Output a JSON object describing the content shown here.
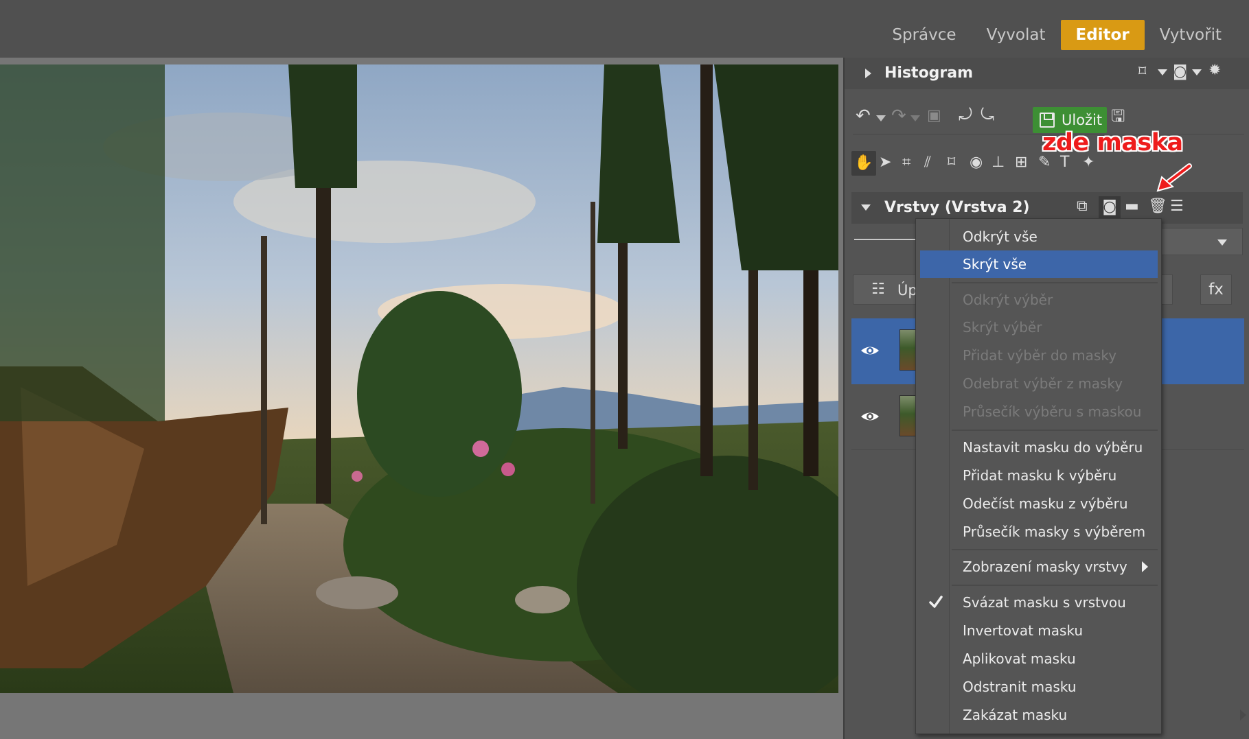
{
  "top_tabs": [
    "Správce",
    "Vyvolat",
    "Editor",
    "Vytvořit"
  ],
  "active_tab": "Editor",
  "colors": {
    "accent": "#d99a14",
    "selection": "#3c66a8",
    "save_green": "#3d8f34",
    "annotation": "#ee1c1c"
  },
  "panel": {
    "histogram_title": "Histogram",
    "save_label": "Uložit",
    "annotation": "zde maska",
    "layers_title": "Vrstvy (Vrstva 2)",
    "adjust_label": "Úp",
    "fx_label": "fx"
  },
  "menu": {
    "items": [
      {
        "label": "Odkrýt vše",
        "state": "normal"
      },
      {
        "label": "Skrýt vše",
        "state": "highlighted"
      },
      {
        "label": "Odkrýt výběr",
        "state": "disabled"
      },
      {
        "label": "Skrýt výběr",
        "state": "disabled"
      },
      {
        "label": "Přidat výběr do masky",
        "state": "disabled"
      },
      {
        "label": "Odebrat výběr z masky",
        "state": "disabled"
      },
      {
        "label": "Průsečík výběru s maskou",
        "state": "disabled"
      },
      {
        "label": "Nastavit masku do výběru",
        "state": "normal"
      },
      {
        "label": "Přidat masku k výběru",
        "state": "normal"
      },
      {
        "label": "Odečíst masku z výběru",
        "state": "normal"
      },
      {
        "label": "Průsečík masky s výběrem",
        "state": "normal"
      },
      {
        "label": "Zobrazení masky vrstvy",
        "state": "submenu"
      },
      {
        "label": "Svázat masku s vrstvou",
        "state": "checked"
      },
      {
        "label": "Invertovat masku",
        "state": "normal"
      },
      {
        "label": "Aplikovat masku",
        "state": "normal"
      },
      {
        "label": "Odstranit masku",
        "state": "normal"
      },
      {
        "label": "Zakázat masku",
        "state": "normal"
      }
    ]
  },
  "icons": [
    "undo-icon",
    "redo-icon",
    "rotate-left-icon",
    "rotate-right-icon",
    "save-icon",
    "hand-icon",
    "pointer-icon",
    "crop-icon",
    "perspective-icon",
    "eye-icon",
    "gear-icon",
    "mask-icon",
    "folder-icon",
    "trash-icon",
    "menu-icon"
  ]
}
